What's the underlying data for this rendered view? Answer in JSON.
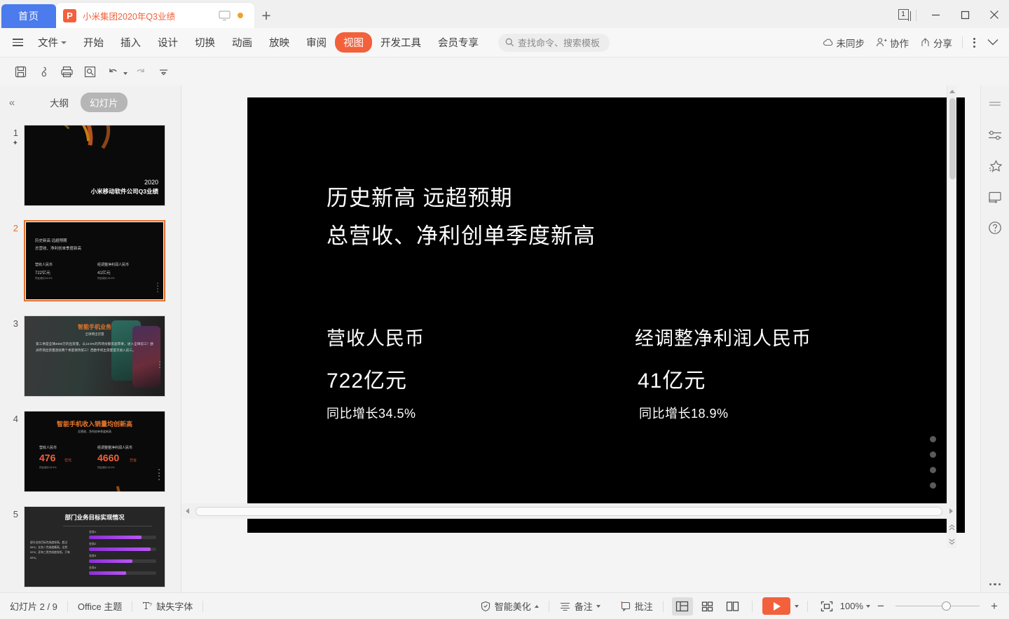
{
  "titlebar": {
    "home_tab": "首页",
    "doc_tab": {
      "icon": "wps-presentation-icon",
      "label": "小米集团2020年Q3业绩",
      "badge": "P"
    },
    "new_tab_icon": "plus-icon",
    "window_count": "1",
    "minimize_icon": "minimize-icon",
    "maximize_icon": "maximize-icon",
    "close_icon": "close-icon"
  },
  "ribbon": {
    "menu_icon": "hamburger-icon",
    "file": "文件",
    "tabs": [
      {
        "label": "开始",
        "active": false
      },
      {
        "label": "插入",
        "active": false
      },
      {
        "label": "设计",
        "active": false
      },
      {
        "label": "切换",
        "active": false
      },
      {
        "label": "动画",
        "active": false
      },
      {
        "label": "放映",
        "active": false
      },
      {
        "label": "审阅",
        "active": false
      },
      {
        "label": "视图",
        "active": true
      },
      {
        "label": "开发工具",
        "active": false
      },
      {
        "label": "会员专享",
        "active": false
      }
    ],
    "search_placeholder": "查找命令、搜索模板",
    "sync_status": "未同步",
    "collaborate": "协作",
    "share": "分享"
  },
  "quick_access": {
    "items": [
      {
        "name": "save-icon"
      },
      {
        "name": "output-icon"
      },
      {
        "name": "print-icon"
      },
      {
        "name": "print-preview-icon"
      },
      {
        "name": "undo-icon"
      },
      {
        "name": "redo-icon"
      },
      {
        "name": "customize-icon"
      }
    ]
  },
  "left_pane": {
    "collapse_icon": "double-chevron-left-icon",
    "tabs": [
      {
        "label": "大纲",
        "active": false
      },
      {
        "label": "幻灯片",
        "active": true
      }
    ],
    "add_slide_icon": "plus-icon",
    "slides": [
      {
        "number": "1",
        "selected": false,
        "starred": true,
        "title": "2020",
        "subtitle": "小米移动软件公司Q3业绩"
      },
      {
        "number": "2",
        "selected": true,
        "line1": "历史新高 远超预期",
        "line2": "总营收、净利创单季度新高",
        "col1_label": "营收人民币",
        "col1_value": "722亿元",
        "col1_sub": "同比增长34.5%",
        "col2_label": "经调整净利润人民币",
        "col2_value": "41亿元",
        "col2_sub": "同比增长18.9%"
      },
      {
        "number": "3",
        "selected": false,
        "title": "智能手机业务",
        "subtitle": "全球两出货量",
        "body": "第三季度全球4660万的出货量，以13.5%的市场份额反超苹果，进入全球前三！欧洲市场出货量连续两个季度保持第三！西欧手机出货量首次进入前三。"
      },
      {
        "number": "4",
        "selected": false,
        "title": "智能手机收入销量均创新高",
        "subtitle": "总营收、净利创单季度新高",
        "col1_label": "营收人民币",
        "col1_value": "476",
        "col1_unit": "亿元",
        "col1_sub": "同比增长34.5%",
        "col2_label": "经调整整净利润人民币",
        "col2_value": "4660",
        "col2_unit": "万台",
        "col2_sub": "同比增长18.9%"
      },
      {
        "number": "5",
        "selected": false,
        "title": "部门业务目标实现情况",
        "body": "部分业务目标完成度较高，超过85%；业务二完成度最高，达到92%；还有三类完成度较低，只有69%。",
        "bars": [
          {
            "label": "业务1",
            "value": 78
          },
          {
            "label": "业务2",
            "value": 92
          },
          {
            "label": "业务3",
            "value": 64
          },
          {
            "label": "业务4",
            "value": 55
          }
        ]
      }
    ]
  },
  "slide": {
    "headline_1": "历史新高 远超预期",
    "headline_2": "总营收、净利创单季度新高",
    "columns": [
      {
        "label": "营收人民币",
        "value": "722亿元",
        "sub": "同比增长34.5%"
      },
      {
        "label": "经调整净利润人民币",
        "value": "41亿元",
        "sub": "同比增长18.9%"
      }
    ]
  },
  "right_rail": {
    "items": [
      {
        "name": "lines-icon"
      },
      {
        "name": "sliders-icon"
      },
      {
        "name": "sparkle-star-icon"
      },
      {
        "name": "screen-cast-icon"
      },
      {
        "name": "help-icon"
      }
    ],
    "more_icon": "more-dots-icon"
  },
  "status_bar": {
    "slide_count": "幻灯片 2 / 9",
    "theme": "Office 主题",
    "missing_font": "缺失字体",
    "beautify": "智能美化",
    "notes": "备注",
    "comments": "批注",
    "views": [
      {
        "name": "normal-view",
        "active": true
      },
      {
        "name": "slide-sorter-view",
        "active": false
      },
      {
        "name": "reading-view",
        "active": false
      }
    ],
    "play_label": "play-slideshow",
    "fit_icon": "fit-to-window-icon",
    "zoom_level": "100%",
    "zoom_out": "−",
    "zoom_in": "+"
  },
  "colors": {
    "accent": "#f2613c",
    "home_tab": "#4b7bec",
    "selection": "#e1702c",
    "panel": "#f1f1f1"
  }
}
